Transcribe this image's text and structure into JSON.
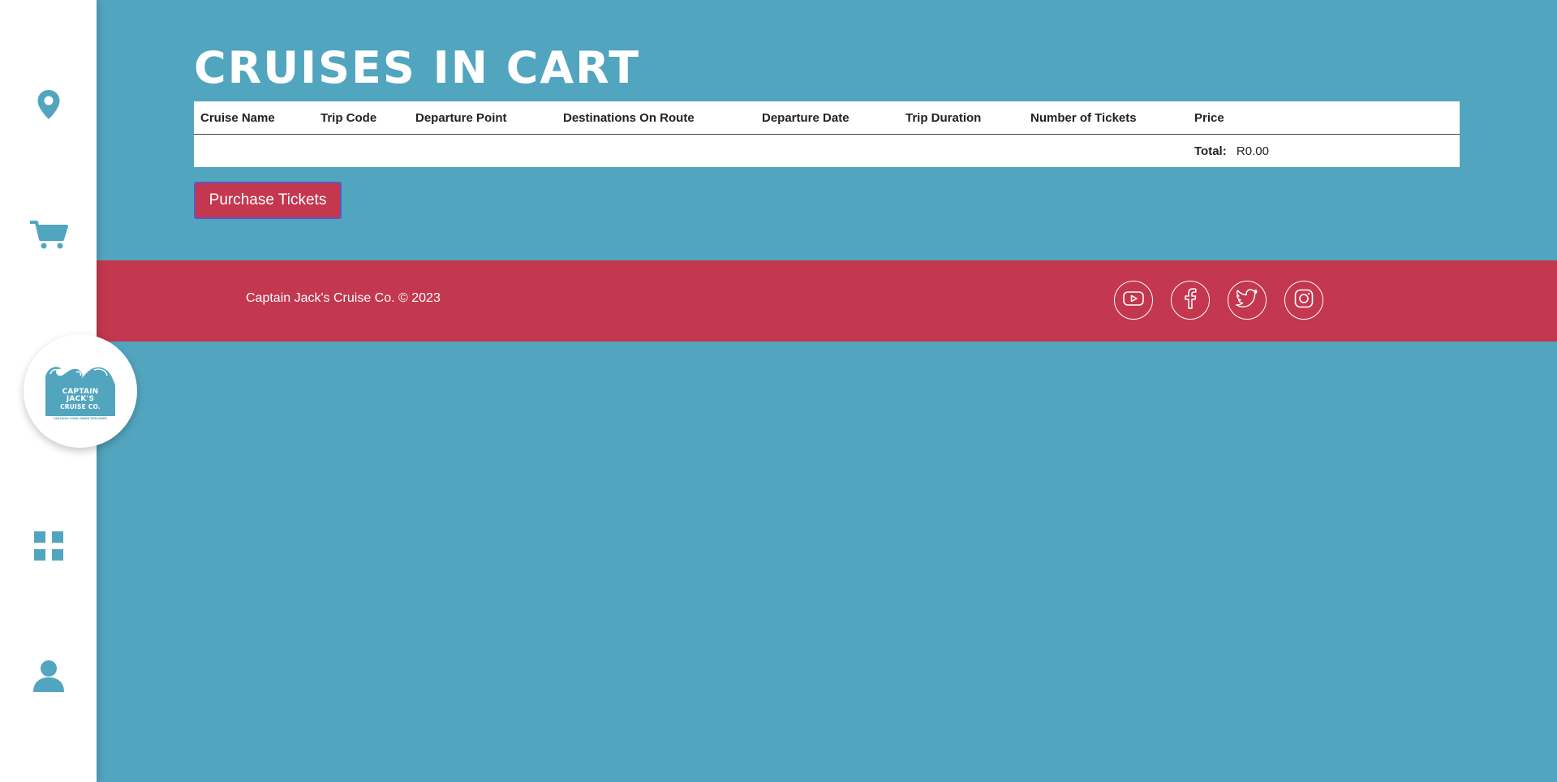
{
  "sidebar": {
    "items": [
      {
        "icon": "location-pin-icon"
      },
      {
        "icon": "cart-icon"
      },
      {
        "icon": "grid-icon"
      },
      {
        "icon": "user-icon"
      }
    ],
    "logo": {
      "line1": "CAPTAIN",
      "line2": "JACK'S",
      "line3": "CRUISE CO.",
      "tagline": "UNLEASH YOUR INNER EXPLORER"
    },
    "icon_color": "#52a5bf"
  },
  "main": {
    "title": "Cruises in Cart",
    "table": {
      "headers": [
        "Cruise Name",
        "Trip Code",
        "Departure Point",
        "Destinations On Route",
        "Departure Date",
        "Trip Duration",
        "Number of Tickets",
        "Price"
      ],
      "rows": [],
      "total_label": "Total:",
      "total_value": "R0.00"
    },
    "purchase_button": "Purchase Tickets"
  },
  "footer": {
    "copyright": "Captain Jack's Cruise Co. © 2023",
    "social": [
      "youtube-icon",
      "facebook-icon",
      "twitter-icon",
      "instagram-icon"
    ]
  },
  "colors": {
    "background": "#52a5bf",
    "accent": "#c3374f",
    "sidebar": "#ffffff"
  }
}
